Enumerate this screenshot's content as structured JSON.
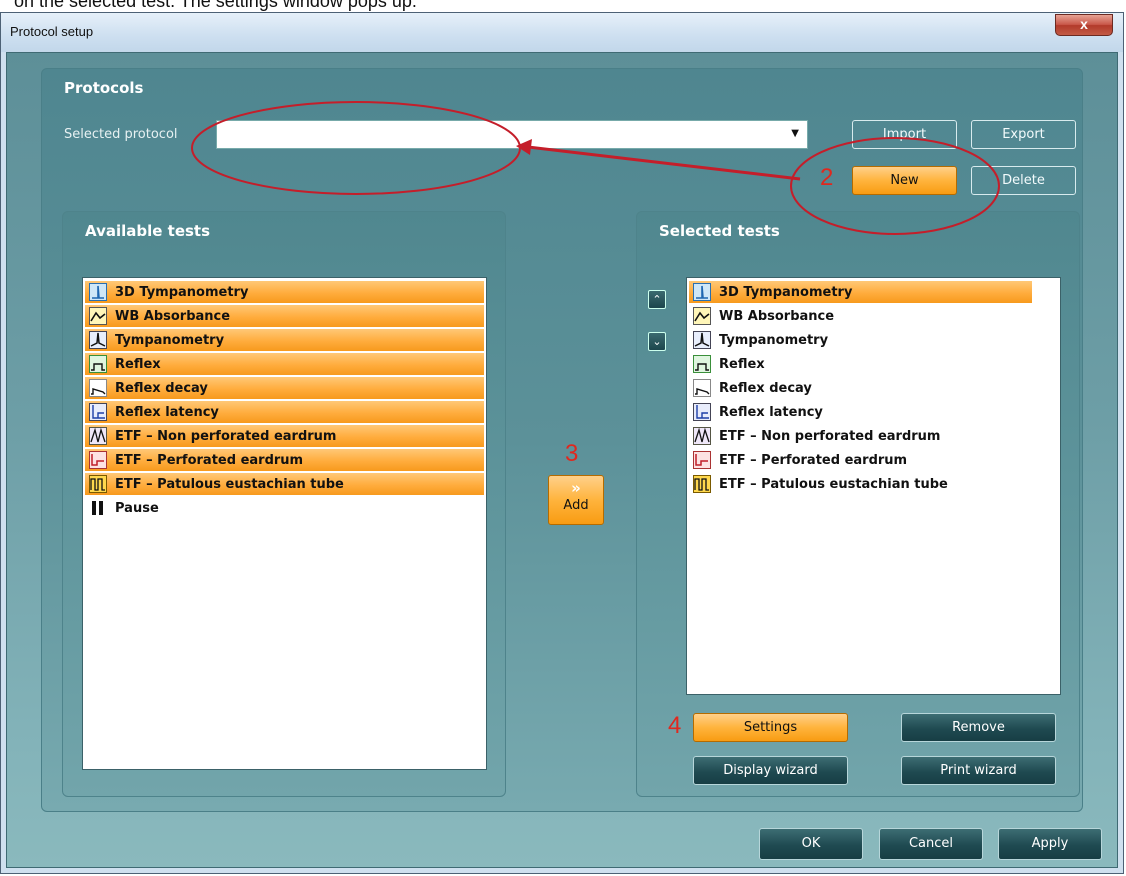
{
  "caption": "on the selected test. The settings window pops up.",
  "window": {
    "title": "Protocol setup",
    "close_glyph": "x"
  },
  "protocols": {
    "title": "Protocols",
    "selected_label": "Selected protocol",
    "selected_value": "",
    "buttons": {
      "import": "Import",
      "export": "Export",
      "new": "New",
      "delete": "Delete"
    }
  },
  "available": {
    "title": "Available tests",
    "items": [
      {
        "label": "3D Tympanometry",
        "icon": "3d-tympanometry-icon",
        "selected": true
      },
      {
        "label": "WB Absorbance",
        "icon": "wb-absorbance-icon",
        "selected": true
      },
      {
        "label": "Tympanometry",
        "icon": "tympanometry-icon",
        "selected": true
      },
      {
        "label": "Reflex",
        "icon": "reflex-icon",
        "selected": true
      },
      {
        "label": "Reflex decay",
        "icon": "reflex-decay-icon",
        "selected": true
      },
      {
        "label": "Reflex latency",
        "icon": "reflex-latency-icon",
        "selected": true
      },
      {
        "label": "ETF – Non perforated eardrum",
        "icon": "etf-non-perforated-icon",
        "selected": true
      },
      {
        "label": "ETF – Perforated eardrum",
        "icon": "etf-perforated-icon",
        "selected": true
      },
      {
        "label": "ETF – Patulous eustachian tube",
        "icon": "etf-patulous-icon",
        "selected": true
      },
      {
        "label": "Pause",
        "icon": "pause-icon",
        "selected": false
      }
    ]
  },
  "add_button": {
    "label": "Add",
    "glyph": "»"
  },
  "selected_tests": {
    "title": "Selected tests",
    "items": [
      {
        "label": "3D Tympanometry",
        "icon": "3d-tympanometry-icon",
        "selected": true
      },
      {
        "label": "WB Absorbance",
        "icon": "wb-absorbance-icon",
        "selected": false
      },
      {
        "label": "Tympanometry",
        "icon": "tympanometry-icon",
        "selected": false
      },
      {
        "label": "Reflex",
        "icon": "reflex-icon",
        "selected": false
      },
      {
        "label": "Reflex decay",
        "icon": "reflex-decay-icon",
        "selected": false
      },
      {
        "label": "Reflex latency",
        "icon": "reflex-latency-icon",
        "selected": false
      },
      {
        "label": "ETF – Non perforated eardrum",
        "icon": "etf-non-perforated-icon",
        "selected": false
      },
      {
        "label": "ETF – Perforated eardrum",
        "icon": "etf-perforated-icon",
        "selected": false
      },
      {
        "label": "ETF – Patulous eustachian tube",
        "icon": "etf-patulous-icon",
        "selected": false
      }
    ],
    "move_up_glyph": "⌃",
    "move_down_glyph": "⌄",
    "buttons": {
      "settings": "Settings",
      "remove": "Remove",
      "display_wizard": "Display wizard",
      "print_wizard": "Print wizard"
    }
  },
  "footer": {
    "ok": "OK",
    "cancel": "Cancel",
    "apply": "Apply"
  },
  "annotations": {
    "step2": "2",
    "step3": "3",
    "step4": "4"
  },
  "colors": {
    "accent_orange": "#ffb43d",
    "annotation_red": "#c41e2a",
    "panel_teal": "#5c9199"
  }
}
